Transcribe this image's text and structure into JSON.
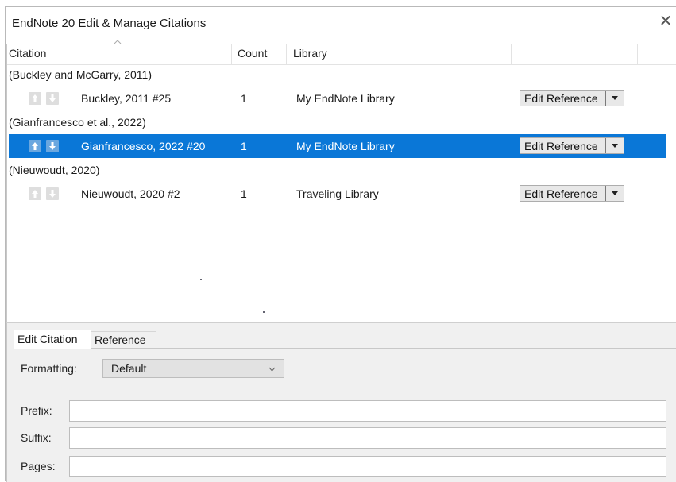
{
  "window": {
    "title": "EndNote 20 Edit & Manage Citations",
    "close_glyph": "✕"
  },
  "columns": {
    "citation": "Citation",
    "count": "Count",
    "library": "Library"
  },
  "rows": [
    {
      "group": "(Buckley and McGarry, 2011)",
      "ref": "Buckley, 2011 #25",
      "count": "1",
      "library": "My EndNote Library",
      "action": "Edit Reference",
      "selected": false
    },
    {
      "group": "(Gianfrancesco et al., 2022)",
      "ref": "Gianfrancesco, 2022 #20",
      "count": "1",
      "library": "My EndNote Library",
      "action": "Edit Reference",
      "selected": true
    },
    {
      "group": "(Nieuwoudt, 2020)",
      "ref": "Nieuwoudt, 2020 #2",
      "count": "1",
      "library": "Traveling Library",
      "action": "Edit Reference",
      "selected": false
    }
  ],
  "tabs": {
    "edit_citation": "Edit Citation",
    "reference": "Reference"
  },
  "form": {
    "formatting_label": "Formatting:",
    "formatting_value": "Default",
    "prefix_label": "Prefix:",
    "prefix_value": "",
    "suffix_label": "Suffix:",
    "suffix_value": "",
    "pages_label": "Pages:",
    "pages_value": ""
  },
  "colors": {
    "selection": "#0a77d7",
    "button_bg": "#e8e8e8",
    "panel_bg": "#f0f0f0"
  },
  "icons": [
    "up-arrow-icon",
    "down-arrow-icon",
    "dropdown-arrow-icon",
    "close-icon",
    "sort-caret-icon"
  ]
}
